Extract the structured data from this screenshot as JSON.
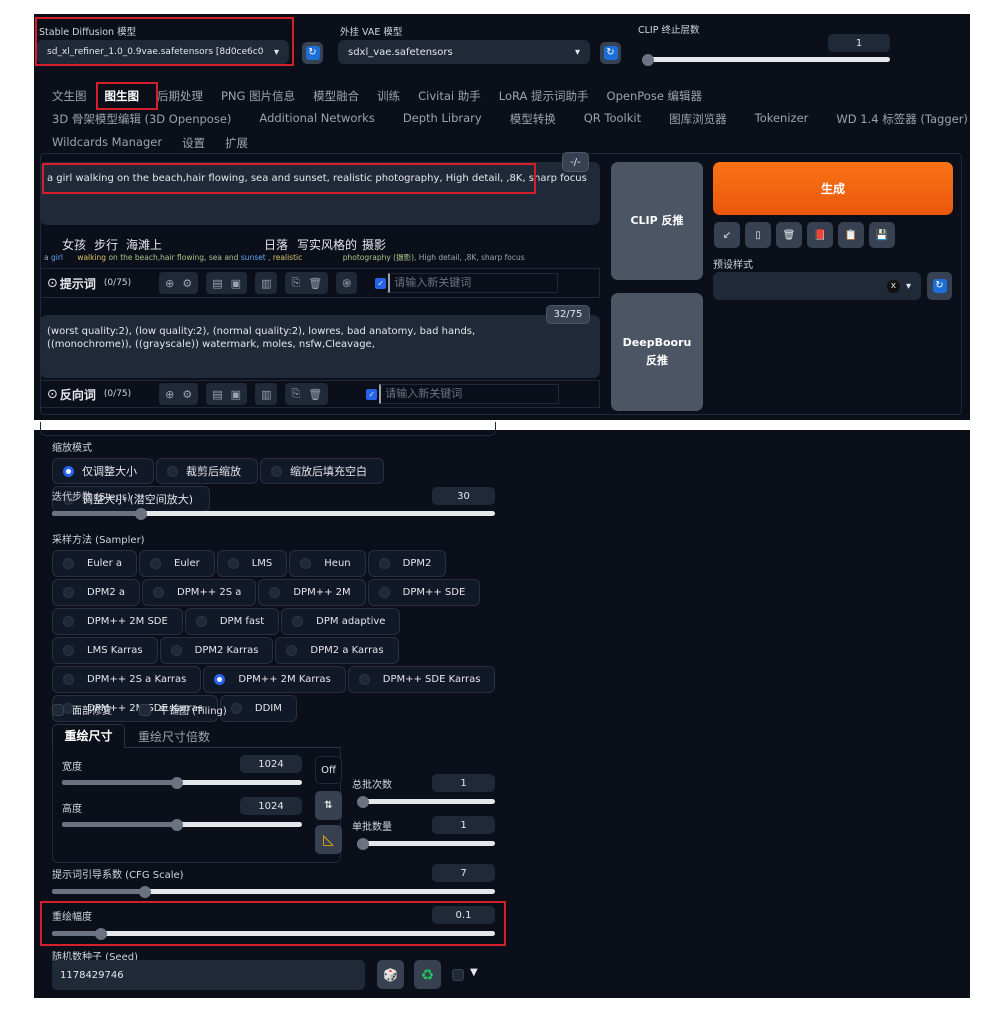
{
  "top": {
    "sd_model": {
      "label": "Stable Diffusion 模型",
      "value": "sd_xl_refiner_1.0_0.9vae.safetensors [8d0ce6c0"
    },
    "vae_model": {
      "label": "外挂 VAE 模型",
      "value": "sdxl_vae.safetensors"
    },
    "clip_skip": {
      "label": "CLIP 终止层数",
      "value": "1",
      "fraction": 0.0
    },
    "refresh_icon": "↻"
  },
  "tabs": {
    "row1": [
      "文生图",
      "图生图",
      "后期处理",
      "PNG 图片信息",
      "模型融合",
      "训练",
      "Civitai 助手",
      "LoRA 提示词助手",
      "OpenPose 编辑器"
    ],
    "row2": [
      "3D 骨架模型编辑 (3D Openpose)",
      "Additional Networks",
      "Depth Library",
      "模型转换",
      "QR Toolkit",
      "图库浏览器",
      "Tokenizer",
      "WD 1.4 标签器 (Tagger)"
    ],
    "row3": [
      "Wildcards Manager",
      "设置",
      "扩展"
    ],
    "active": "图生图"
  },
  "prompt": {
    "toggle": "-/-",
    "text": "a girl walking on the beach,hair flowing, sea and sunset, realistic photography,  High detail, ,8K, sharp focus",
    "translation_cn": [
      "女孩",
      "步行",
      "海滩上",
      "日落",
      "写实风格的",
      "摄影"
    ],
    "translation_en": {
      "a": "a ",
      "girl": "girl",
      "walking": "walking",
      "mid": " on the beach,hair flowing, sea and ",
      "sunset": "sunset",
      "comma": " , ",
      "realistic": "realistic",
      "photography": "photography (摄影)",
      "rest": ", High detail, ,8K, sharp focus"
    },
    "label": "提示词",
    "count": "(0/75)",
    "keyword_placeholder": "请输入新关键词"
  },
  "negative": {
    "counter": "32/75",
    "text": "(worst quality:2), (low quality:2), (normal quality:2), lowres, bad anatomy, bad hands, ((monochrome)), ((grayscale)) watermark, moles, nsfw,Cleavage,",
    "label": "反向词",
    "count": "(0/75)",
    "keyword_placeholder": "请输入新关键词"
  },
  "actions": {
    "clip_interrogate": "CLIP 反推",
    "deepbooru_line1": "DeepBooru",
    "deepbooru_line2": "反推",
    "generate": "生成",
    "generate_color": "#f97316",
    "tool_icons": [
      "↙",
      "▯",
      "🗑",
      "📕",
      "📋",
      "💾"
    ],
    "styles_label": "预设样式",
    "styles_clear": "x"
  },
  "settings": {
    "resize_mode": {
      "label": "缩放模式",
      "options": [
        "仅调整大小",
        "裁剪后缩放",
        "缩放后填充空白",
        "调整大小 (潜空间放大)"
      ],
      "selected": 0
    },
    "steps": {
      "label": "迭代步数 (Steps)",
      "value": "30",
      "fraction": 0.2
    },
    "sampler": {
      "label": "采样方法 (Sampler)",
      "options": [
        "Euler a",
        "Euler",
        "LMS",
        "Heun",
        "DPM2",
        "DPM2 a",
        "DPM++ 2S a",
        "DPM++ 2M",
        "DPM++ SDE",
        "DPM++ 2M SDE",
        "DPM fast",
        "DPM adaptive",
        "LMS Karras",
        "DPM2 Karras",
        "DPM2 a Karras",
        "DPM++ 2S a Karras",
        "DPM++ 2M Karras",
        "DPM++ SDE Karras",
        "DPM++ 2M SDE Karras",
        "DDIM"
      ],
      "selected": "DPM++ 2M Karras"
    },
    "face_restore": "面部修复",
    "tiling": "平铺图 (Tiling)",
    "size_tabs": [
      "重绘尺寸",
      "重绘尺寸倍数"
    ],
    "width": {
      "label": "宽度",
      "value": "1024",
      "fraction": 0.48
    },
    "height": {
      "label": "高度",
      "value": "1024",
      "fraction": 0.48
    },
    "off_button": "Off",
    "swap_icon": "⇅",
    "ruler_icon": "◺",
    "batch_count": {
      "label": "总批次数",
      "value": "1",
      "fraction": 0.0
    },
    "batch_size": {
      "label": "单批数量",
      "value": "1",
      "fraction": 0.0
    },
    "cfg": {
      "label": "提示词引导系数 (CFG Scale)",
      "value": "7",
      "fraction": 0.21
    },
    "denoise": {
      "label": "重绘幅度",
      "value": "0.1",
      "fraction": 0.11
    },
    "seed": {
      "label": "随机数种子 (Seed)",
      "value": "1178429746",
      "dice_icon": "🎲",
      "recycle_icon": "♻",
      "extra_toggle": "▼"
    }
  }
}
